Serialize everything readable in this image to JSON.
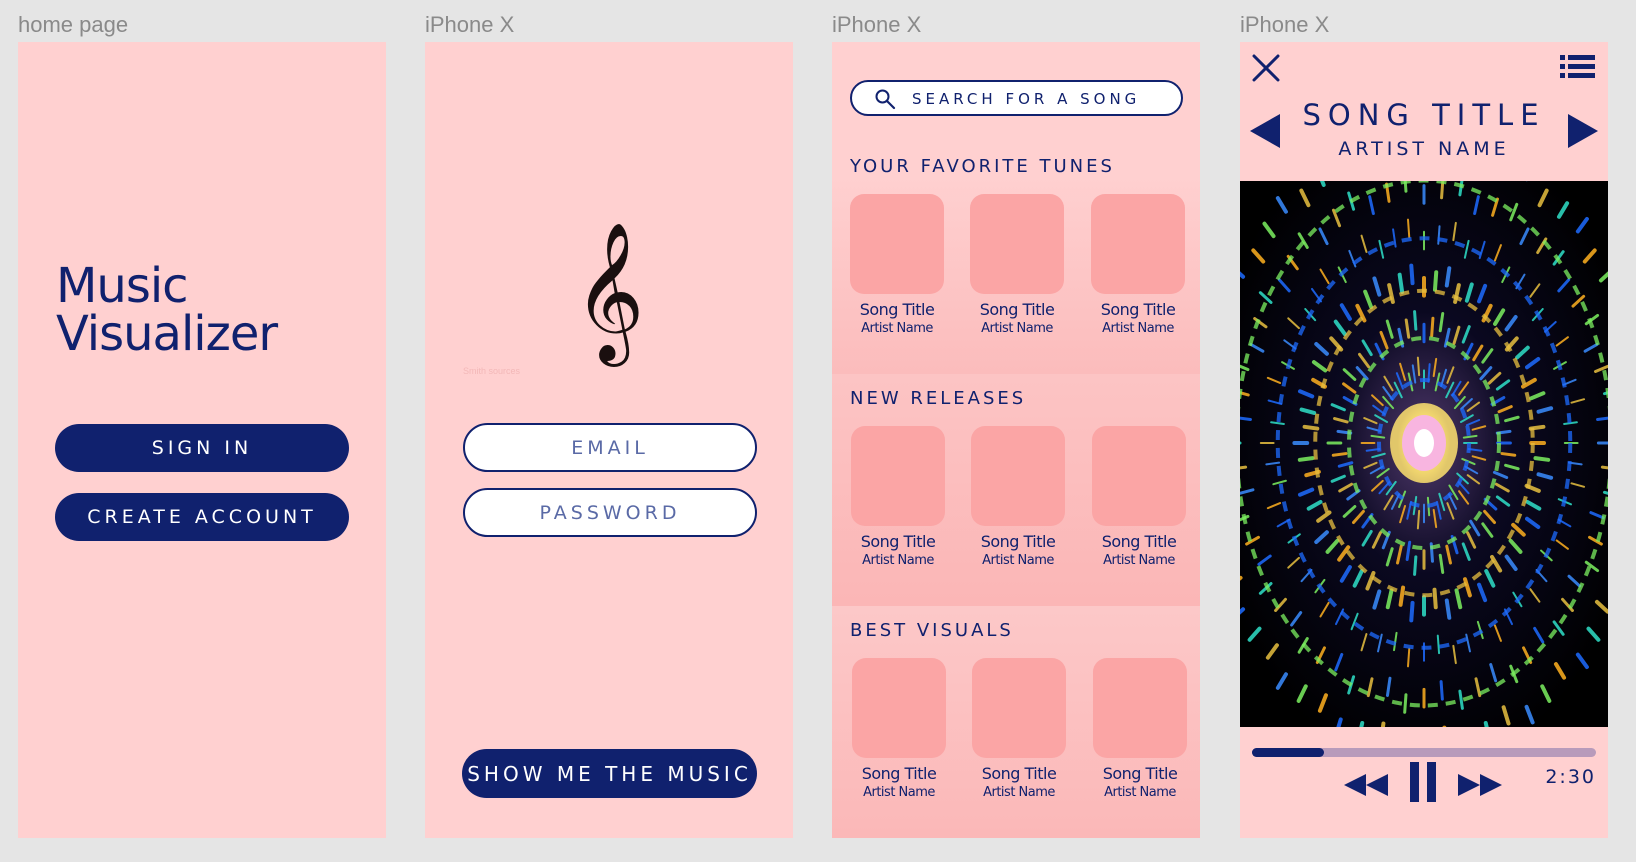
{
  "frame_labels": [
    "home page",
    "iPhone X",
    "iPhone X",
    "iPhone X"
  ],
  "home": {
    "title_line1": "Music",
    "title_line2": "Visualizer",
    "sign_in_label": "SIGN IN",
    "create_account_label": "CREATE ACCOUNT"
  },
  "login": {
    "clef_glyph": "𝄞",
    "credit_text": "Smith sources",
    "email_placeholder": "EMAIL",
    "password_placeholder": "PASSWORD",
    "submit_label": "SHOW ME THE MUSIC"
  },
  "browse": {
    "search_placeholder": "SEARCH FOR A SONG",
    "sections": [
      {
        "title": "YOUR FAVORITE TUNES",
        "items": [
          {
            "song": "Song Title",
            "artist": "Artist Name"
          },
          {
            "song": "Song Title",
            "artist": "Artist Name"
          },
          {
            "song": "Song Title",
            "artist": "Artist Name"
          }
        ]
      },
      {
        "title": "NEW RELEASES",
        "items": [
          {
            "song": "Song Title",
            "artist": "Artist Name"
          },
          {
            "song": "Song Title",
            "artist": "Artist Name"
          },
          {
            "song": "Song Title",
            "artist": "Artist Name"
          }
        ]
      },
      {
        "title": "BEST VISUALS",
        "items": [
          {
            "song": "Song Title",
            "artist": "Artist Name"
          },
          {
            "song": "Song Title",
            "artist": "Artist Name"
          },
          {
            "song": "Song Title",
            "artist": "Artist Name"
          }
        ]
      }
    ]
  },
  "player": {
    "song_title": "SONG TITLE",
    "artist_name": "ARTIST NAME",
    "progress_fraction": 0.21,
    "time": "2:30",
    "icons": [
      "close-icon",
      "playlist-icon",
      "previous-track-icon",
      "next-track-icon",
      "rewind-icon",
      "pause-icon",
      "fast-forward-icon"
    ]
  },
  "colors": {
    "background": "#e5e5e5",
    "frame": "#ffd0d0",
    "accent": "#10216e",
    "card": "#fba5a5",
    "progress_track": "#b89bbb"
  }
}
